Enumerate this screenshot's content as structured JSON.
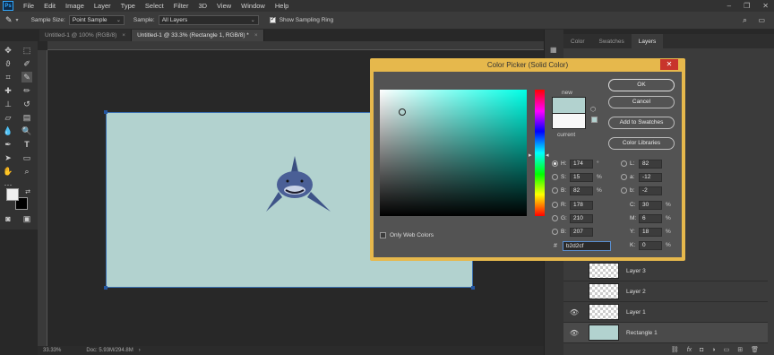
{
  "app": {
    "logo": "Ps"
  },
  "menu": [
    "File",
    "Edit",
    "Image",
    "Layer",
    "Type",
    "Select",
    "Filter",
    "3D",
    "View",
    "Window",
    "Help"
  ],
  "window_controls": [
    "–",
    "❐",
    "✕"
  ],
  "options_bar": {
    "sample_size_label": "Sample Size:",
    "sample_size_value": "Point Sample",
    "sample_label": "Sample:",
    "sample_value": "All Layers",
    "show_ring_label": "Show Sampling Ring",
    "show_ring_checked": true
  },
  "tabs": [
    {
      "label": "Untitled-1 @ 100% (RGB/8)",
      "active": false
    },
    {
      "label": "Untitled-1 @ 33.3% (Rectangle 1, RGB/8) *",
      "active": true
    }
  ],
  "status": {
    "zoom": "33.33%",
    "doc": "Doc: 5.93M/294.8M"
  },
  "panel": {
    "tabs": [
      {
        "label": "Color",
        "active": false
      },
      {
        "label": "Swatches",
        "active": false
      },
      {
        "label": "Layers",
        "active": true
      }
    ],
    "layers": [
      {
        "name": "Layer 3",
        "visible": false,
        "selected": false
      },
      {
        "name": "Layer 2",
        "visible": false,
        "selected": false
      },
      {
        "name": "Layer 1",
        "visible": true,
        "selected": false
      },
      {
        "name": "Rectangle 1",
        "visible": true,
        "selected": true
      }
    ],
    "bottom_icons": [
      "link-icon",
      "fx-icon",
      "mask-icon",
      "adjustment-icon",
      "group-icon",
      "new-layer-icon",
      "trash-icon"
    ]
  },
  "document": {
    "fill_color": "#b2d2cf"
  },
  "color_picker": {
    "title": "Color Picker (Solid Color)",
    "close": "✕",
    "new_label": "new",
    "current_label": "current",
    "new_color": "#b2d2cf",
    "current_color": "#f8f8f8",
    "buttons": {
      "ok": "OK",
      "cancel": "Cancel",
      "add_to_swatches": "Add to Swatches",
      "color_libraries": "Color Libraries"
    },
    "hsb": {
      "h_label": "H:",
      "h_value": "174",
      "h_unit": "°",
      "s_label": "S:",
      "s_value": "15",
      "s_unit": "%",
      "b_label": "B:",
      "b_value": "82",
      "b_unit": "%"
    },
    "rgb": {
      "r_label": "R:",
      "r_value": "178",
      "g_label": "G:",
      "g_value": "210",
      "b_label": "B:",
      "b_value": "207"
    },
    "lab": {
      "l_label": "L:",
      "l_value": "82",
      "a_label": "a:",
      "a_value": "-12",
      "b_label": "b:",
      "b_value": "-2"
    },
    "cmyk": {
      "c_label": "C:",
      "c_value": "30",
      "c_unit": "%",
      "m_label": "M:",
      "m_value": "6",
      "m_unit": "%",
      "y_label": "Y:",
      "y_value": "18",
      "y_unit": "%",
      "k_label": "K:",
      "k_value": "0",
      "k_unit": "%"
    },
    "only_web_colors": "Only Web Colors",
    "hex_label": "#",
    "hex_value": "b2d2cf",
    "selected_mode": "H"
  }
}
